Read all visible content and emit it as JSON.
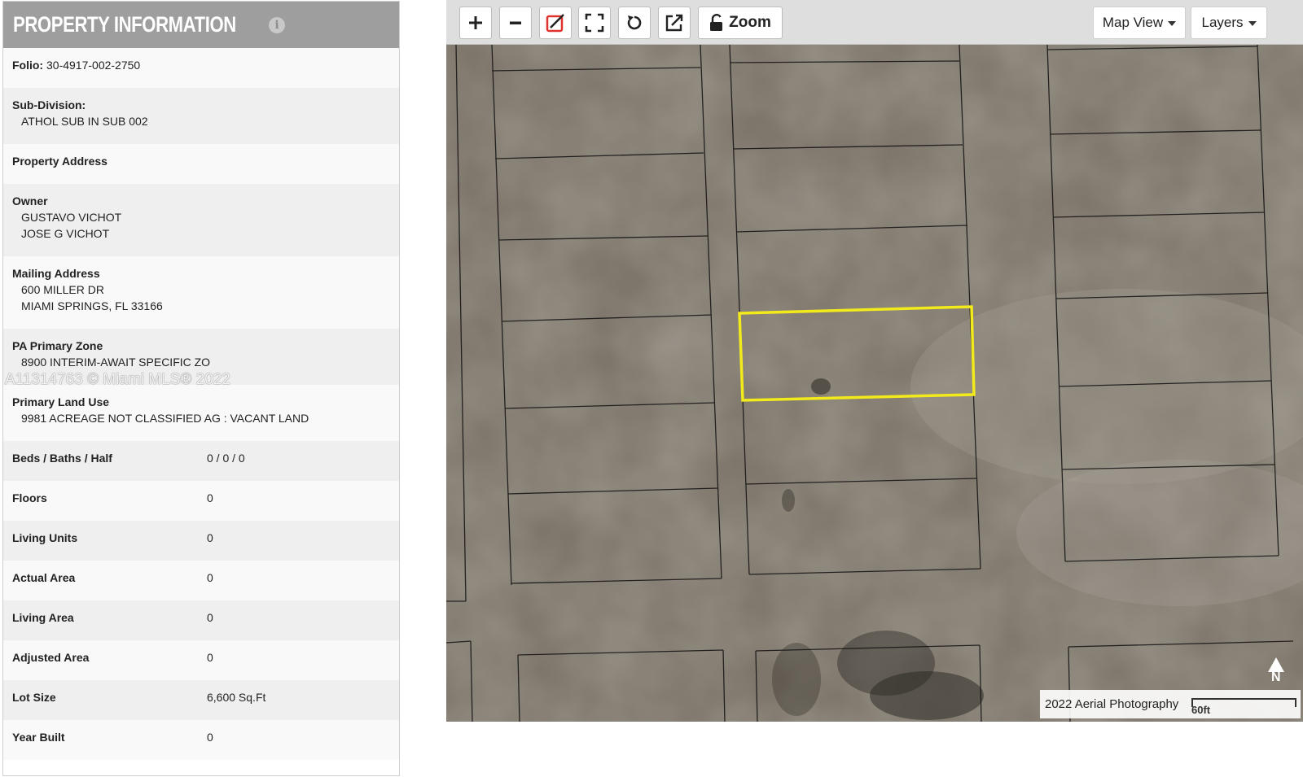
{
  "panel": {
    "title": "PROPERTY INFORMATION",
    "info_icon": "info-icon",
    "watermark": "A11314763 © Miami MLS® 2022",
    "folio": {
      "label": "Folio:",
      "value": "30-4917-002-2750"
    },
    "subdivision": {
      "label": "Sub-Division:",
      "value": "ATHOL SUB IN SUB 002"
    },
    "property_address": {
      "label": "Property Address"
    },
    "owner": {
      "label": "Owner",
      "lines": [
        "GUSTAVO VICHOT",
        "JOSE G VICHOT"
      ]
    },
    "mailing_address": {
      "label": "Mailing Address",
      "lines": [
        "600 MILLER DR",
        "MIAMI SPRINGS, FL 33166"
      ]
    },
    "primary_zone": {
      "label": "PA Primary Zone",
      "value": "8900 INTERIM-AWAIT SPECIFIC ZO"
    },
    "land_use": {
      "label": "Primary Land Use",
      "value": "9981 ACREAGE NOT CLASSIFIED AG : VACANT LAND"
    },
    "facts": [
      {
        "label": "Beds / Baths / Half",
        "value": "0 / 0 / 0"
      },
      {
        "label": "Floors",
        "value": "0"
      },
      {
        "label": "Living Units",
        "value": "0"
      },
      {
        "label": "Actual Area",
        "value": "0"
      },
      {
        "label": "Living Area",
        "value": "0"
      },
      {
        "label": "Adjusted Area",
        "value": "0"
      },
      {
        "label": "Lot Size",
        "value": "6,600 Sq.Ft"
      },
      {
        "label": "Year Built",
        "value": "0"
      }
    ]
  },
  "map": {
    "toolbar": {
      "zoom_in_icon": "plus-icon",
      "zoom_out_icon": "minus-icon",
      "draw_icon": "draw-icon",
      "fullscreen_icon": "fullscreen-icon",
      "refresh_icon": "refresh-icon",
      "export_icon": "export-icon",
      "zoom_label": "Zoom",
      "map_view_label": "Map View",
      "layers_label": "Layers"
    },
    "scale_caption": "2022 Aerial Photography",
    "scale_label": "60ft",
    "north_label": "N",
    "highlight_color": "#f2ea1b"
  }
}
